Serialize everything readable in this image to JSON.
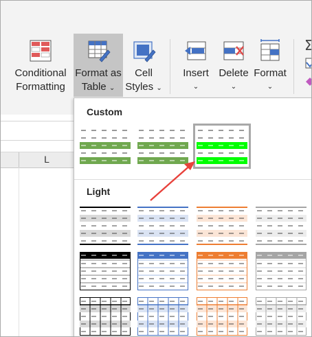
{
  "ribbon": {
    "conditional_formatting": "Conditional Formatting",
    "format_as_table_1": "Format as",
    "format_as_table_2": "Table",
    "cell_styles_1": "Cell",
    "cell_styles_2": "Styles",
    "insert": "Insert",
    "delete": "Delete",
    "format": "Format",
    "chevron": "⌄"
  },
  "sheet": {
    "column_label": "L"
  },
  "gallery": {
    "sections": [
      "Custom",
      "Light"
    ],
    "custom_styles": [
      {
        "band": "#70a84f"
      },
      {
        "band": "#70a84f"
      },
      {
        "band": "#00ff00",
        "selected": true
      }
    ],
    "light_rows": [
      [
        "banded-gray",
        "banded-blue",
        "banded-orange",
        "banded-lightgray"
      ],
      [
        "header-black",
        "header-blue",
        "header-orange",
        "header-gray"
      ],
      [
        "grid-black",
        "grid-blue",
        "grid-orange",
        "grid-gray"
      ]
    ]
  },
  "colors": {
    "ribbon_bg": "#f3f3f3",
    "active_button": "#c5c5c5",
    "arrow": "#e8413b",
    "blue": "#4472c4",
    "orange": "#ed7d31",
    "gray": "#a5a5a5"
  }
}
